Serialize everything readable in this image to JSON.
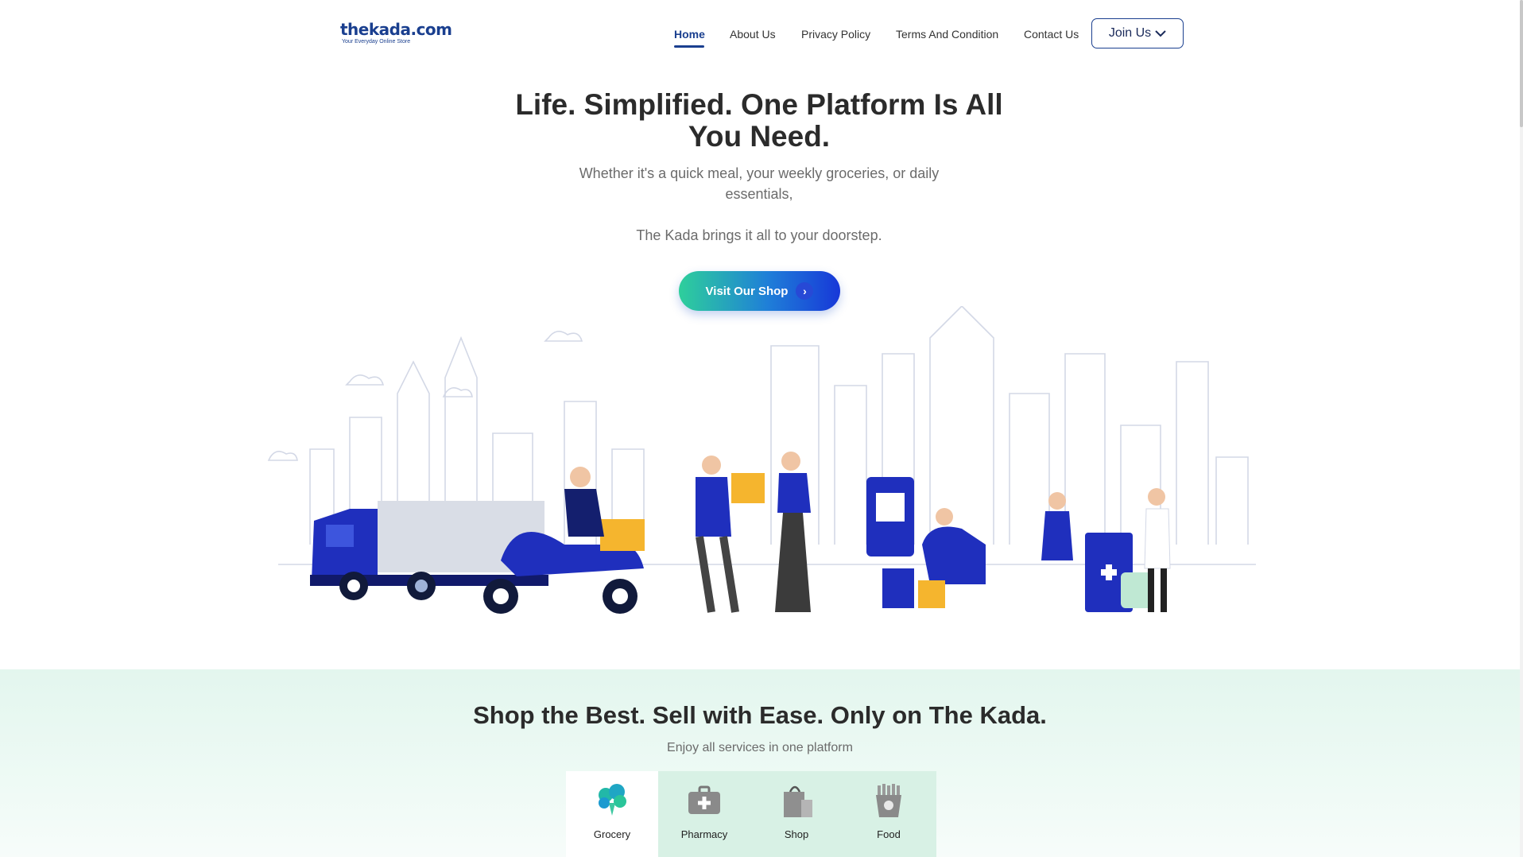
{
  "header": {
    "logo_text": "thekada.com",
    "logo_tagline": "Your Everyday Online Store",
    "nav": [
      {
        "label": "Home",
        "active": true
      },
      {
        "label": "About Us",
        "active": false
      },
      {
        "label": "Privacy Policy",
        "active": false
      },
      {
        "label": "Terms And Condition",
        "active": false
      },
      {
        "label": "Contact Us",
        "active": false
      }
    ],
    "join_label": "Join Us"
  },
  "hero": {
    "title": "Life. Simplified. One Platform Is All You Need.",
    "subtitle": "Whether it's a quick meal, your weekly groceries, or daily essentials,",
    "subtitle2": "The Kada brings it all to your doorstep.",
    "cta_label": "Visit Our Shop"
  },
  "services": {
    "title": "Shop the Best. Sell with Ease. Only on The Kada.",
    "subtitle": "Enjoy all services in one platform",
    "tabs": [
      {
        "label": "Grocery",
        "icon": "broccoli-icon",
        "active": true
      },
      {
        "label": "Pharmacy",
        "icon": "medical-kit-icon",
        "active": false
      },
      {
        "label": "Shop",
        "icon": "shopping-bag-icon",
        "active": false
      },
      {
        "label": "Food",
        "icon": "fries-icon",
        "active": false
      }
    ]
  },
  "colors": {
    "brand": "#1a3f8f",
    "accent_blue": "#1738d8",
    "accent_green": "#2ecf9b",
    "section_bg": "#e3f6ee"
  }
}
